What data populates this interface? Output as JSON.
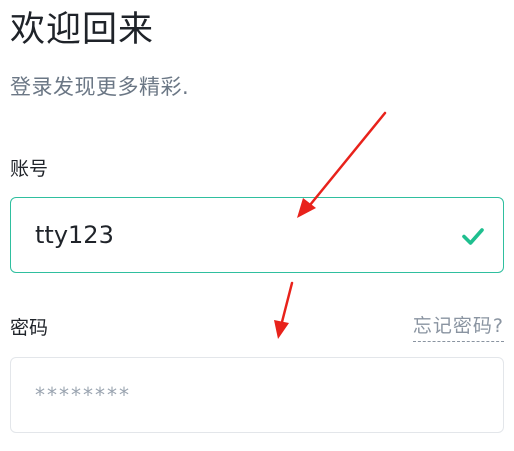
{
  "header": {
    "title": "欢迎回来",
    "subtitle": "登录发现更多精彩."
  },
  "account": {
    "label": "账号",
    "value": "tty123",
    "status_icon": "check-icon",
    "status_color": "#1fbf8f",
    "border_color": "#2fbf9f"
  },
  "password": {
    "label": "密码",
    "placeholder": "********",
    "forgot_link": "忘记密码?"
  },
  "annotations": {
    "arrow_color": "#e8221b"
  }
}
